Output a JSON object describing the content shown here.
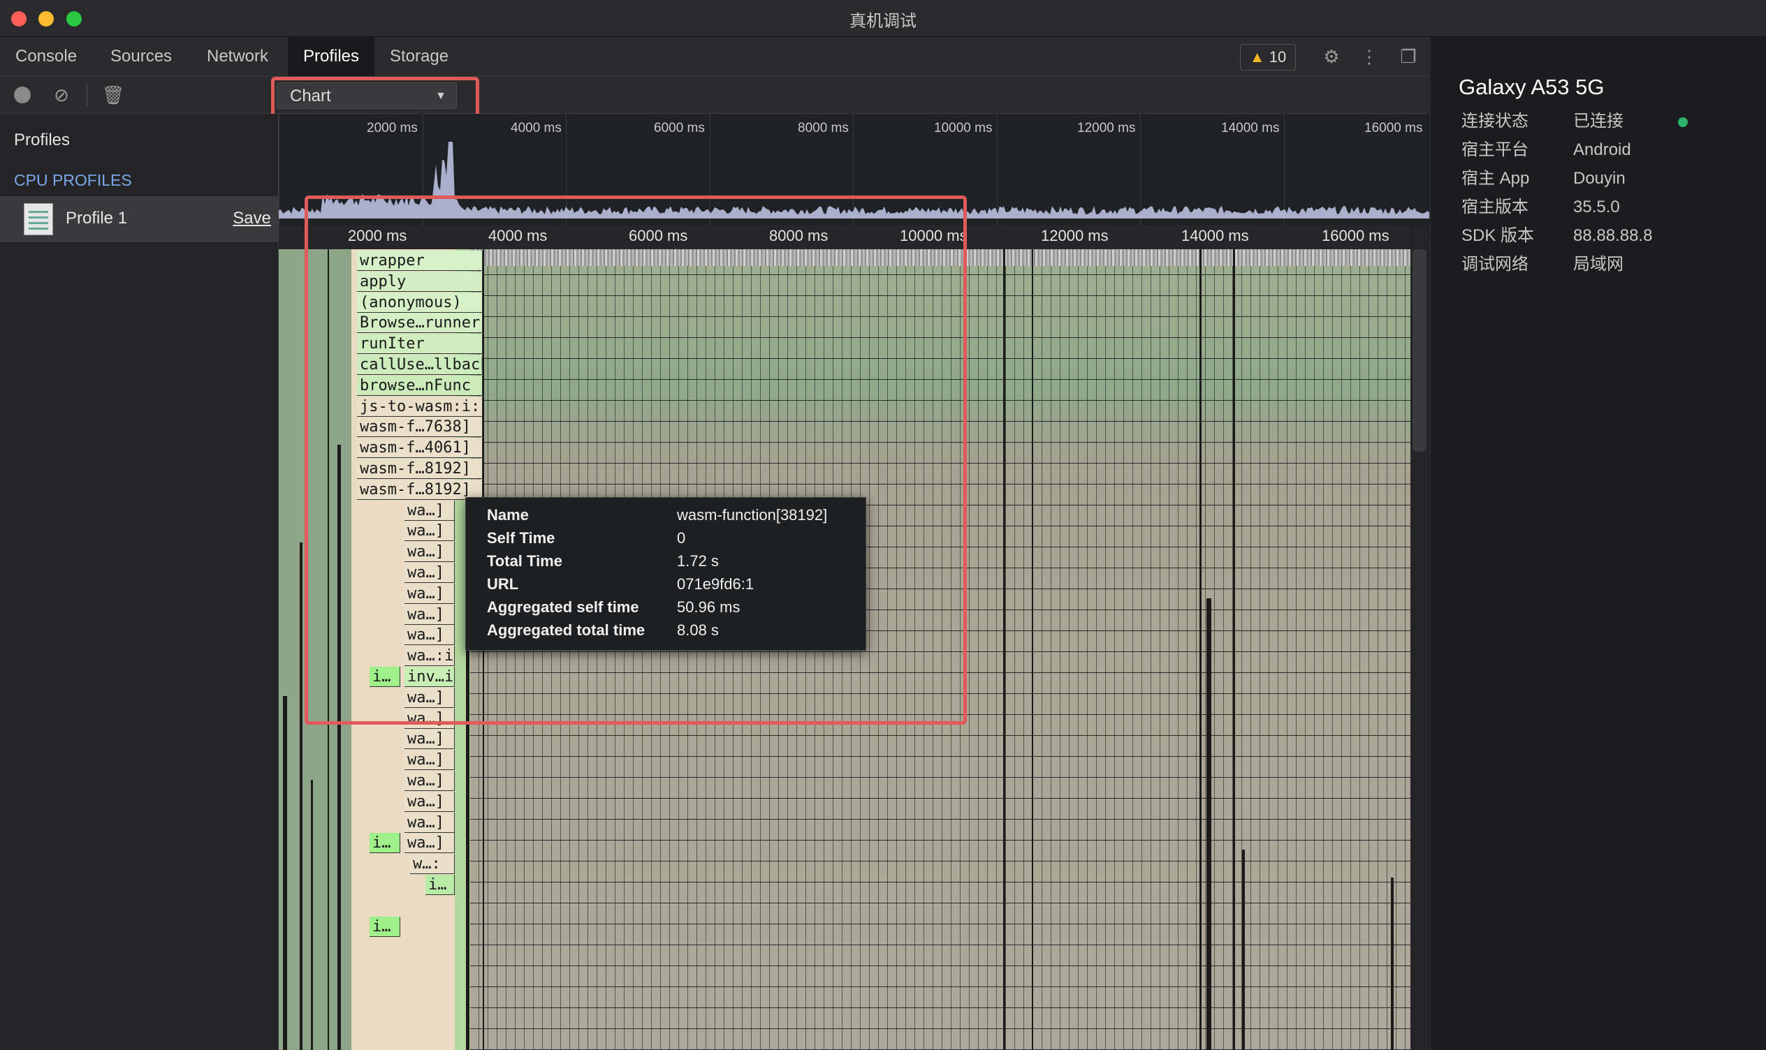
{
  "window": {
    "title": "真机调试"
  },
  "tabs": [
    "Console",
    "Sources",
    "Network",
    "Profiles",
    "Storage"
  ],
  "active_tab": "Profiles",
  "warning_count": "10",
  "toolbar": {
    "view_select": "Chart"
  },
  "sidebar": {
    "title": "Profiles",
    "section": "CPU PROFILES",
    "profile": {
      "name": "Profile 1",
      "save_label": "Save"
    }
  },
  "overview_ticks": [
    "2000 ms",
    "4000 ms",
    "6000 ms",
    "8000 ms",
    "10000 ms",
    "12000 ms",
    "14000 ms",
    "16000 ms"
  ],
  "ruler_ticks": [
    "2000 ms",
    "4000 ms",
    "6000 ms",
    "8000 ms",
    "10000 ms",
    "12000 ms",
    "14000 ms",
    "16000 ms"
  ],
  "flame_frames": [
    "wrapper",
    "apply",
    "(anonymous)",
    "Browse…runner",
    "runIter",
    "callUse…llback",
    "browse…nFunc",
    "js-to-wasm:i:",
    "wasm-f…7638]",
    "wasm-f…4061]",
    "wasm-f…8192]",
    "wasm-f…8192]"
  ],
  "flame_sub_frames": [
    "wa…]",
    "wa…]",
    "wa…]",
    "wa…]",
    "wa…]",
    "wa…]",
    "wa…]",
    "wa…:i",
    "inv…ii",
    "wa…]",
    "wa…]",
    "wa…]",
    "wa…]",
    "wa…]",
    "wa…]",
    "wa…]",
    "wa…]",
    "w…:",
    "i…"
  ],
  "flame_side_labels": [
    "i…",
    "i…",
    "i…"
  ],
  "tooltip": {
    "rows": [
      {
        "key": "Name",
        "value": "wasm-function[38192]"
      },
      {
        "key": "Self Time",
        "value": "0"
      },
      {
        "key": "Total Time",
        "value": "1.72 s"
      },
      {
        "key": "URL",
        "value": "071e9fd6:1"
      },
      {
        "key": "Aggregated self time",
        "value": "50.96 ms"
      },
      {
        "key": "Aggregated total time",
        "value": "8.08 s"
      }
    ]
  },
  "device": {
    "name": "Galaxy A53 5G",
    "info": [
      {
        "label": "连接状态",
        "value": "已连接"
      },
      {
        "label": "宿主平台",
        "value": "Android"
      },
      {
        "label": "宿主 App",
        "value": "Douyin"
      },
      {
        "label": "宿主版本",
        "value": "35.5.0"
      },
      {
        "label": "SDK 版本",
        "value": "88.88.88.8"
      },
      {
        "label": "调试网络",
        "value": "局域网"
      }
    ],
    "status_color": "#2fb36b"
  },
  "colors": {
    "highlight_box": "#e05a5a",
    "accent_link": "#7aa7e8",
    "warning": "#f5b72a"
  }
}
